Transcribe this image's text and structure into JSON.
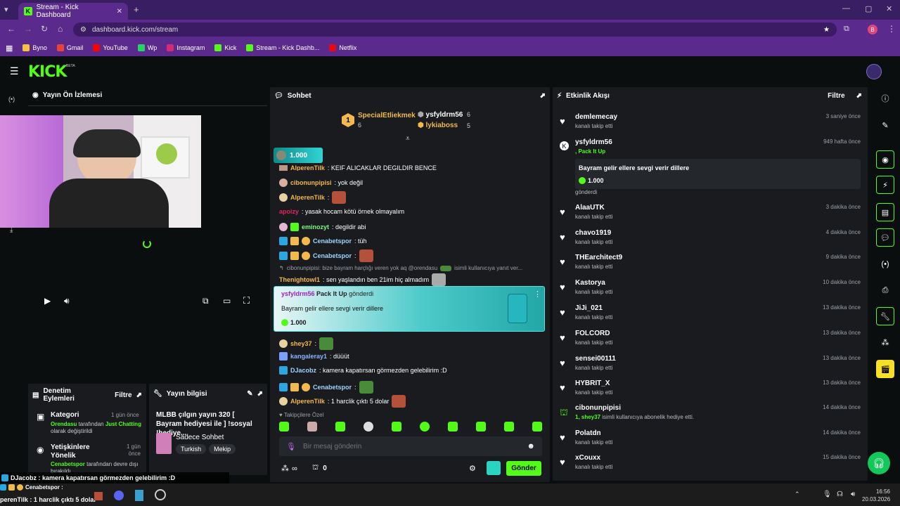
{
  "browser": {
    "tab_title": "Stream - Kick Dashboard",
    "url": "dashboard.kick.com/stream",
    "profile_initial": "B",
    "bookmarks": [
      "Byno",
      "Gmail",
      "YouTube",
      "Wp",
      "Instagram",
      "Kick",
      "Stream - Kick Dashb...",
      "Netflix"
    ]
  },
  "header": {
    "logo": "KICK",
    "beta": "BETA"
  },
  "preview": {
    "title": "Yayın Ön İzlemesi"
  },
  "chat": {
    "title": "Sohbet",
    "leaderboard": [
      {
        "rank": "1",
        "name": "SpecialEtliekmek",
        "count": "6"
      },
      {
        "name": "ysfyldrm56",
        "count": "6"
      },
      {
        "name": "lykiaboss",
        "count": "5"
      }
    ],
    "pinned_amount": "1.000",
    "lines": [
      {
        "user": "AlperenTilk",
        "text": ": KEIF ALICAKLAR DEĞİLDİR BENCE",
        "color": "#f3b94a"
      },
      {
        "user": "cibonunpipisi",
        "text": ": yok değil",
        "color": "#f3b94a"
      },
      {
        "user": "AlperenTilk",
        "text": ":",
        "color": "#f3b94a"
      },
      {
        "user": "apoizy",
        "text": ": yasak hocam kötü örnek olmayalım",
        "color": "#e0245e"
      },
      {
        "user": "eminozyt",
        "text": ": degildir abi",
        "color": "#7cf97c"
      },
      {
        "user": "Cenabetspor",
        "text": ": tüh",
        "color": "#9ed4ff"
      },
      {
        "user": "Cenabetspor",
        "text": ":",
        "color": "#9ed4ff"
      },
      {
        "user": "",
        "text": "cibonunpipisi: bize bayram harçlığı veren yok aq @orendasu",
        "color": "#9aa0a6"
      },
      {
        "user": "",
        "text": "isimli kullanıcıya yanıt ver...",
        "color": "#9aa0a6"
      },
      {
        "user": "Thenightowl1",
        "text": ": sen yaşlandın ben 21im hiç almadım",
        "color": "#f3b94a"
      },
      {
        "user": "shey37",
        "text": ":",
        "color": "#f3b94a"
      },
      {
        "user": "kangaleray1",
        "text": ": düüüt",
        "color": "#8bb4ff"
      },
      {
        "user": "DJacobz",
        "text": ": kamera kapatırsan görmezden gelebilirim :D",
        "color": "#9ed4ff"
      },
      {
        "user": "Cenabetspor",
        "text": ":",
        "color": "#9ed4ff"
      },
      {
        "user": "AlperenTilk",
        "text": ": 1 harclik çıktı 5 dolar",
        "color": "#f3b94a"
      }
    ],
    "gift": {
      "user": "ysfyldrm56",
      "pack": "Pack It Up",
      "suffix": "gönderdi",
      "message": "Bayram gelir ellere sevgi verir dillere",
      "amount": "1.000"
    },
    "followers_only": "Takipçilere Özel",
    "input_placeholder": "Bir mesaj gönderin",
    "infinity": "∞",
    "count": "0",
    "send": "Gönder"
  },
  "activity": {
    "title": "Etkinlik Akışı",
    "filter": "Filtre",
    "items": [
      {
        "name": "demlemecay",
        "sub": "kanalı takip etti",
        "time": "3 saniye önce"
      },
      {
        "name": "AlaaUTK",
        "sub": "kanalı takip etti",
        "time": "3 dakika önce"
      },
      {
        "name": "chavo1919",
        "sub": "kanalı takip etti",
        "time": "4 dakika önce"
      },
      {
        "name": "THEarchitect9",
        "sub": "kanalı takip etti",
        "time": "9 dakika önce"
      },
      {
        "name": "Kastorya",
        "sub": "kanalı takip etti",
        "time": "10 dakika önce"
      },
      {
        "name": "JiJi_021",
        "sub": "kanalı takip etti",
        "time": "13 dakika önce"
      },
      {
        "name": "FOLCORD",
        "sub": "kanalı takip etti",
        "time": "13 dakika önce"
      },
      {
        "name": "sensei00111",
        "sub": "kanalı takip etti",
        "time": "13 dakika önce"
      },
      {
        "name": "HYBRIT_X",
        "sub": "kanalı takip etti",
        "time": "13 dakika önce"
      },
      {
        "name": "cibonunpipisi",
        "sub": "isimli kullanıcıya abonelik hediye etti.",
        "sub_pre": "1, shey37",
        "time": "14 dakika önce"
      },
      {
        "name": "Polatdn",
        "sub": "kanalı takip etti",
        "time": "14 dakika önce"
      },
      {
        "name": "xCouxx",
        "sub": "kanalı takip etti",
        "time": "15 dakika önce"
      }
    ],
    "kicks": {
      "name": "ysfyldrm56",
      "pack": ", Pack It Up",
      "message": "Bayram gelir ellere sevgi verir dillere",
      "amount": "1.000",
      "sub": "gönderdi",
      "time": "949 hafta önce"
    }
  },
  "moderation": {
    "title": "Denetim Eylemleri",
    "filter": "Filtre",
    "items": [
      {
        "title": "Kategori",
        "time": "1 gün önce",
        "actor": "Orendasu",
        "text": "tarafından",
        "target": "Just Chatting",
        "suffix": "olarak değiştirildi"
      },
      {
        "title": "Yetişkinlere Yönelik",
        "time": "1 gün önce",
        "actor": "Cenabetspor",
        "text": "tarafından devre dışı bırakıldı"
      }
    ]
  },
  "stream_info": {
    "title": "Yayın bilgisi",
    "stream_title": "MLBB çılgın yayın 320 [ Bayram hediyesi ile ] !sosyal !hediye...",
    "category": "Sadece Sohbet",
    "tags": [
      "Turkish",
      "Mekip"
    ]
  },
  "overlay": {
    "line1": "DJacobz : kamera kapatırsan görmezden gelebilirim :D",
    "line2": "Cenabetspor :",
    "line3": "perenTilk : 1 harclik çıktı 5 dolar"
  },
  "taskbar": {
    "time": "16:56",
    "date": "20.03.2026"
  }
}
